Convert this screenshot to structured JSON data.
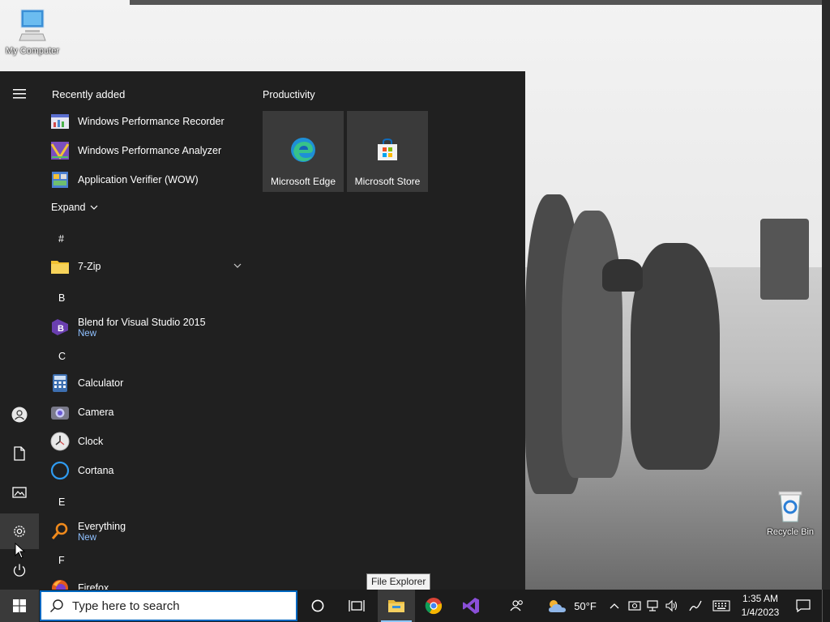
{
  "desktop": {
    "icons": [
      {
        "label": "My Computer",
        "icon": "computer-icon"
      },
      {
        "label": "Recycle Bin",
        "icon": "recycle-bin-icon"
      }
    ]
  },
  "start_menu": {
    "recent_header": "Recently added",
    "recent_apps": [
      {
        "label": "Windows Performance Recorder",
        "icon": "performance-recorder-icon"
      },
      {
        "label": "Windows Performance Analyzer",
        "icon": "performance-analyzer-icon"
      },
      {
        "label": "Application Verifier (WOW)",
        "icon": "app-verifier-icon"
      }
    ],
    "expand_label": "Expand",
    "sections": {
      "hash": "#",
      "b": "B",
      "c": "C",
      "e": "E",
      "f": "F"
    },
    "apps": {
      "zip": {
        "label": "7-Zip",
        "icon": "folder-icon"
      },
      "blend": {
        "label": "Blend for Visual Studio 2015",
        "badge": "New",
        "icon": "blend-icon"
      },
      "calculator": {
        "label": "Calculator",
        "icon": "calculator-icon"
      },
      "camera": {
        "label": "Camera",
        "icon": "camera-icon"
      },
      "clock": {
        "label": "Clock",
        "icon": "clock-icon"
      },
      "cortana": {
        "label": "Cortana",
        "icon": "cortana-icon"
      },
      "everything": {
        "label": "Everything",
        "badge": "New",
        "icon": "everything-search-icon"
      },
      "firefox": {
        "label": "Firefox",
        "icon": "firefox-icon"
      }
    },
    "tiles_header": "Productivity",
    "tiles": [
      {
        "label": "Microsoft Edge",
        "icon": "edge-icon"
      },
      {
        "label": "Microsoft Store",
        "icon": "store-icon"
      }
    ]
  },
  "tooltip": "File Explorer",
  "taskbar": {
    "search_placeholder": "Type here to search",
    "weather": "50°F",
    "time": "1:35 AM",
    "date": "1/4/2023"
  },
  "colors": {
    "start_bg": "#202020",
    "accent": "#0067c0",
    "new_badge": "#8fc0ff",
    "taskbar_bg": "#1c1c1c"
  }
}
